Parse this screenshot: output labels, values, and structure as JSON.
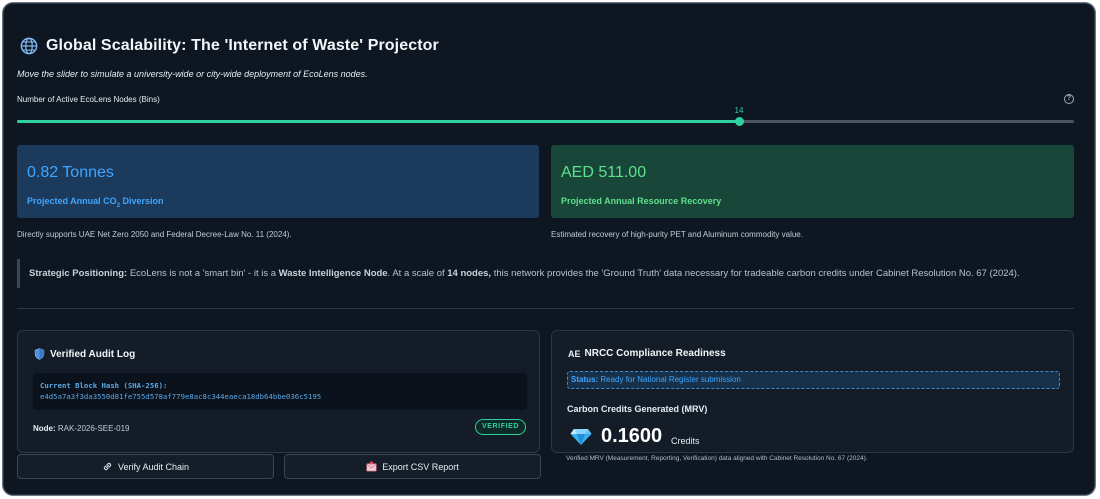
{
  "header": {
    "title": "Global Scalability: The 'Internet of Waste' Projector",
    "subtitle": "Move the slider to simulate a university-wide or city-wide deployment of EcoLens nodes."
  },
  "slider": {
    "label": "Number of Active EcoLens Nodes (Bins)",
    "value": "14",
    "fill_fraction": 0.683,
    "help_icon": "question-circle-icon",
    "help_glyph": "?",
    "accent_color": "#2fd0a2"
  },
  "metrics": {
    "co2": {
      "value": "0.82 Tonnes",
      "label_prefix": "Projected Annual CO",
      "label_sub": "2",
      "label_suffix": " Diversion",
      "caption": "Directly supports UAE Net Zero 2050 and Federal Decree-Law No. 11 (2024).",
      "color": "#3fa6ff"
    },
    "recovery": {
      "value": "AED 511.00",
      "label": "Projected Annual Resource Recovery",
      "caption": "Estimated recovery of high-purity PET and Aluminum commodity value.",
      "color": "#5fe08a"
    }
  },
  "strategic": {
    "lead": "Strategic Positioning:",
    "text1": " EcoLens is not a 'smart bin' - it is a ",
    "bold1": "Waste Intelligence Node",
    "text2": ". At a scale of ",
    "bold2": "14 nodes,",
    "text3": " this network provides the 'Ground Truth' data necessary for tradeable carbon credits under Cabinet Resolution No. 67 (2024)."
  },
  "audit": {
    "title": "Verified Audit Log",
    "icon": "shield-icon",
    "hash_label": "Current Block Hash (SHA-256):",
    "hash_value": "e4d5a7a3f3da3550d81fe755d578af779e8ac8c344eaeca18db64bbe036c5195",
    "node_label": "Node:",
    "node_value": " RAK-2026-SEE-019",
    "badge": "VERIFIED"
  },
  "nrcc": {
    "icon_text": "AE",
    "title": "NRCC Compliance Readiness",
    "status_label": "Status:",
    "status_value": " Ready for National Register submission",
    "credits_title": "Carbon Credits Generated (MRV)",
    "credits_value": "0.1600",
    "credits_unit": "Credits",
    "icon": "diamond-icon",
    "caption": "Verified MRV (Measurement, Reporting, Verification) data aligned with Cabinet Resolution No. 67 (2024)."
  },
  "buttons": {
    "verify": {
      "label": "Verify Audit Chain",
      "icon": "link-icon"
    },
    "export": {
      "label": "Export CSV Report",
      "icon": "envelope-icon"
    }
  }
}
